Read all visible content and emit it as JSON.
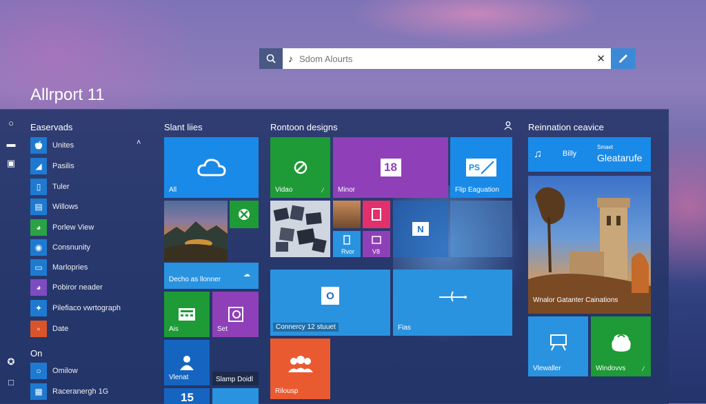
{
  "brand": "Allrport 11",
  "search": {
    "placeholder": "Sdom Alourts",
    "note_glyph": "♪",
    "clear_glyph": "✕",
    "go_glyph": "✎"
  },
  "sections": {
    "apps": "Easervads",
    "tiles": "Slant liies",
    "designs": "Rontoon designs",
    "service": "Reinnation ceavice",
    "on": "On"
  },
  "apps": [
    {
      "label": "Unites",
      "icon": "apple-icon",
      "glyph": "",
      "color": "#1e7ad0"
    },
    {
      "label": "Pasilis",
      "icon": "map-icon",
      "glyph": "◢",
      "color": "#1e7ad0"
    },
    {
      "label": "Tuler",
      "icon": "page-icon",
      "glyph": "▯",
      "color": "#1e7ad0"
    },
    {
      "label": "Willows",
      "icon": "window-icon",
      "glyph": "▤",
      "color": "#1e7ad0"
    },
    {
      "label": "Porlew View",
      "icon": "view-icon",
      "glyph": "◕",
      "color": "#2aa245"
    },
    {
      "label": "Consnunity",
      "icon": "community-icon",
      "glyph": "◉",
      "color": "#1e7ad0"
    },
    {
      "label": "Marlopries",
      "icon": "mail-icon",
      "glyph": "▭",
      "color": "#1e7ad0"
    },
    {
      "label": "Pobiror neader",
      "icon": "reader-icon",
      "glyph": "◕",
      "color": "#7e4bc0"
    },
    {
      "label": "Pilefiaco vwrtograph",
      "icon": "photo-icon",
      "glyph": "✦",
      "color": "#1e7ad0"
    },
    {
      "label": "Date",
      "icon": "date-icon",
      "glyph": "▫",
      "color": "#d9542b"
    }
  ],
  "apps2": [
    {
      "label": "Omilow",
      "icon": "circle-icon",
      "glyph": "○",
      "color": "#1e7ad0"
    },
    {
      "label": "Raceranergh 1G",
      "icon": "grid-icon",
      "glyph": "▦",
      "color": "#1e7ad0"
    }
  ],
  "tiles": {
    "all": "All",
    "video": "Vidao",
    "minor": "Minor",
    "number": "18",
    "ps": "PS",
    "flip": "Flip Eaguation",
    "decho": "Decho as llonner",
    "rvor": "Rvor",
    "v8": "V8",
    "connercy": "Connercy 12 stuuet",
    "files": "Fias",
    "ais": "Ais",
    "set": "Set",
    "viewat": "Vlenat",
    "slamp": "Slamp Doidl",
    "rilousp": "Rilousp",
    "num15": "15",
    "n": "N",
    "o": "O"
  },
  "service": {
    "bully": "Billy",
    "gleatarufe_small": "Smaet",
    "gleatarufe": "Gleatarufe",
    "castle_caption": "Wnalor Gatanter Cainations",
    "viewlet": "Vlewaller",
    "windows": "Windovvs"
  },
  "colors": {
    "accent": "#1a8ae8",
    "green": "#1e9a36",
    "purple": "#8f40b8",
    "orange": "#ea5a30"
  }
}
